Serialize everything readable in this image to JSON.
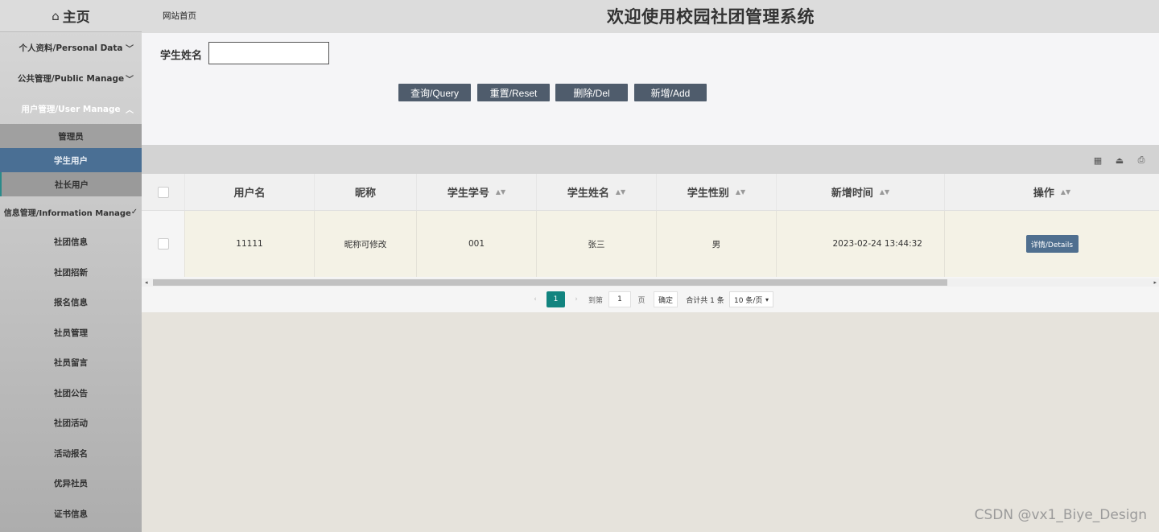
{
  "sidebar": {
    "home_label": "主页",
    "groups": [
      {
        "label": "个人资料/Personal Data"
      },
      {
        "label": "公共管理/Public Manage"
      },
      {
        "label": "用户管理/User Manage"
      }
    ],
    "user_sub": [
      "管理员",
      "学生用户",
      "社长用户"
    ],
    "info_group": "信息管理/Information Manage",
    "info_items": [
      "社团信息",
      "社团招新",
      "报名信息",
      "社员管理",
      "社员留言",
      "社团公告",
      "社团活动",
      "活动报名",
      "优异社员",
      "证书信息"
    ]
  },
  "header": {
    "breadcrumb": "网站首页",
    "title": "欢迎使用校园社团管理系统"
  },
  "search": {
    "label": "学生姓名",
    "value": "",
    "buttons": [
      "查询/Query",
      "重置/Reset",
      "删除/Del",
      "新增/Add"
    ]
  },
  "table": {
    "columns": [
      "用户名",
      "昵称",
      "学生学号",
      "学生姓名",
      "学生性别",
      "新增时间",
      "操作"
    ],
    "rows": [
      {
        "username": "11111",
        "nickname": "昵称可修改",
        "student_no": "001",
        "student_name": "张三",
        "gender": "男",
        "created": "2023-02-24 13:44:32",
        "action": "详情/Details"
      }
    ]
  },
  "pager": {
    "current": "1",
    "goto_label": "到第",
    "page_value": "1",
    "page_suffix": "页",
    "confirm": "确定",
    "total": "合计共 1 条",
    "per_page": "10 条/页"
  },
  "watermark": "CSDN @vx1_Biye_Design"
}
